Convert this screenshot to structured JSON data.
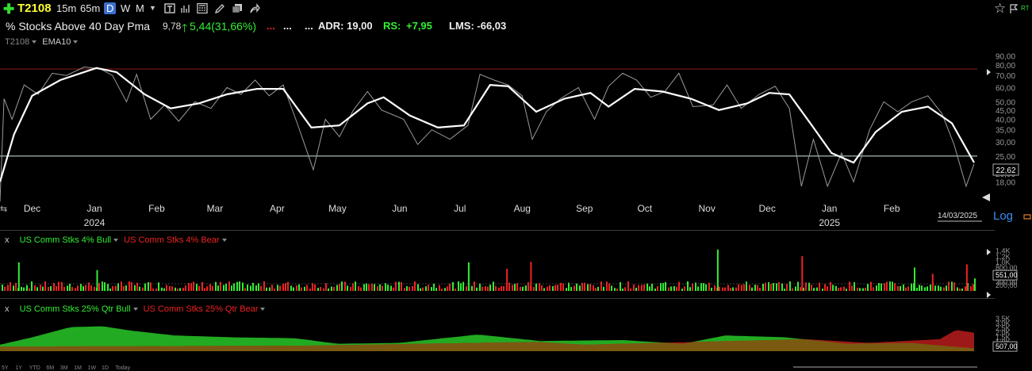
{
  "header": {
    "symbol": "T2108",
    "timeframes": [
      "15m",
      "65m",
      "D",
      "W",
      "M"
    ],
    "active_timeframe": "D",
    "right_badge": "RT"
  },
  "infobar": {
    "name": "% Stocks Above 40 Day Pma",
    "price": "9,78",
    "change": "5,44(31,66%)",
    "dots1": "...",
    "dots2": "...",
    "dots3": "...",
    "adr": "ADR: 19,00",
    "rs_label": "RS:",
    "rs_value": "+7,95",
    "lms": "LMS: -66,03"
  },
  "colors": {
    "up": "#33ee33",
    "down": "#ee2222",
    "symbol": "#ffff33",
    "ema": "#ffffff",
    "price_line": "#9a9a9a",
    "upper_line": "#8a1c1c",
    "lower_line": "#cfe9e2"
  },
  "chart_data": [
    {
      "type": "line",
      "legend": [
        "T2108",
        "EMA10"
      ],
      "x_ticks": [
        "Dec",
        "Jan",
        "Feb",
        "Mar",
        "Apr",
        "May",
        "Jun",
        "Jul",
        "Aug",
        "Sep",
        "Oct",
        "Nov",
        "Dec",
        "Jan",
        "Feb"
      ],
      "year_labels": [
        "2024",
        "2025"
      ],
      "y_scale": "log",
      "y_ticks": [
        "90,00",
        "80,00",
        "70,00",
        "60,00",
        "50,00",
        "45,00",
        "40,00",
        "35,00",
        "30,00",
        "25,00",
        "20,00",
        "18,00"
      ],
      "ylim": [
        16,
        95
      ],
      "last_value": "22,62",
      "date_label": "14/03/2025",
      "log_label": "Log",
      "hlines": [
        76,
        25
      ],
      "ema": [
        [
          "2023-11-15",
          18
        ],
        [
          "2023-11-22",
          33
        ],
        [
          "2023-12-01",
          54
        ],
        [
          "2023-12-15",
          66
        ],
        [
          "2024-01-02",
          77
        ],
        [
          "2024-01-12",
          73
        ],
        [
          "2024-01-26",
          55
        ],
        [
          "2024-02-08",
          46
        ],
        [
          "2024-02-22",
          49
        ],
        [
          "2024-03-07",
          55
        ],
        [
          "2024-03-22",
          59
        ],
        [
          "2024-04-04",
          59
        ],
        [
          "2024-04-18",
          36
        ],
        [
          "2024-05-02",
          37
        ],
        [
          "2024-05-16",
          49
        ],
        [
          "2024-05-24",
          53
        ],
        [
          "2024-06-06",
          42
        ],
        [
          "2024-06-20",
          36
        ],
        [
          "2024-07-03",
          37
        ],
        [
          "2024-07-16",
          62
        ],
        [
          "2024-07-25",
          61
        ],
        [
          "2024-08-08",
          44
        ],
        [
          "2024-08-22",
          52
        ],
        [
          "2024-09-04",
          56
        ],
        [
          "2024-09-13",
          47
        ],
        [
          "2024-09-26",
          59
        ],
        [
          "2024-10-10",
          57
        ],
        [
          "2024-10-24",
          52
        ],
        [
          "2024-11-07",
          45
        ],
        [
          "2024-11-21",
          49
        ],
        [
          "2024-12-02",
          56
        ],
        [
          "2024-12-12",
          55
        ],
        [
          "2024-12-24",
          36
        ],
        [
          "2025-01-02",
          26
        ],
        [
          "2025-01-13",
          23
        ],
        [
          "2025-01-24",
          34
        ],
        [
          "2025-02-06",
          44
        ],
        [
          "2025-02-19",
          47
        ],
        [
          "2025-03-03",
          38
        ],
        [
          "2025-03-14",
          23
        ]
      ],
      "price": [
        [
          "2023-11-15",
          14
        ],
        [
          "2023-11-17",
          52
        ],
        [
          "2023-11-21",
          40
        ],
        [
          "2023-11-27",
          62
        ],
        [
          "2023-12-04",
          55
        ],
        [
          "2023-12-11",
          72
        ],
        [
          "2023-12-18",
          70
        ],
        [
          "2023-12-27",
          78
        ],
        [
          "2024-01-04",
          76
        ],
        [
          "2024-01-10",
          70
        ],
        [
          "2024-01-17",
          50
        ],
        [
          "2024-01-22",
          71
        ],
        [
          "2024-01-29",
          40
        ],
        [
          "2024-02-05",
          48
        ],
        [
          "2024-02-12",
          39
        ],
        [
          "2024-02-20",
          50
        ],
        [
          "2024-02-28",
          46
        ],
        [
          "2024-03-07",
          60
        ],
        [
          "2024-03-14",
          55
        ],
        [
          "2024-03-21",
          66
        ],
        [
          "2024-03-28",
          54
        ],
        [
          "2024-04-04",
          62
        ],
        [
          "2024-04-11",
          38
        ],
        [
          "2024-04-19",
          21
        ],
        [
          "2024-04-25",
          40
        ],
        [
          "2024-05-02",
          32
        ],
        [
          "2024-05-09",
          45
        ],
        [
          "2024-05-16",
          57
        ],
        [
          "2024-05-23",
          45
        ],
        [
          "2024-06-03",
          40
        ],
        [
          "2024-06-10",
          29
        ],
        [
          "2024-06-17",
          35
        ],
        [
          "2024-06-26",
          31
        ],
        [
          "2024-07-05",
          37
        ],
        [
          "2024-07-11",
          71
        ],
        [
          "2024-07-18",
          66
        ],
        [
          "2024-07-25",
          62
        ],
        [
          "2024-08-01",
          54
        ],
        [
          "2024-08-06",
          31
        ],
        [
          "2024-08-13",
          44
        ],
        [
          "2024-08-20",
          52
        ],
        [
          "2024-08-29",
          60
        ],
        [
          "2024-09-06",
          40
        ],
        [
          "2024-09-13",
          61
        ],
        [
          "2024-09-20",
          72
        ],
        [
          "2024-09-27",
          66
        ],
        [
          "2024-10-04",
          53
        ],
        [
          "2024-10-11",
          57
        ],
        [
          "2024-10-18",
          72
        ],
        [
          "2024-10-25",
          47
        ],
        [
          "2024-11-04",
          48
        ],
        [
          "2024-11-11",
          62
        ],
        [
          "2024-11-18",
          46
        ],
        [
          "2024-11-27",
          55
        ],
        [
          "2024-12-05",
          61
        ],
        [
          "2024-12-12",
          46
        ],
        [
          "2024-12-18",
          17
        ],
        [
          "2024-12-24",
          31
        ],
        [
          "2024-12-31",
          17
        ],
        [
          "2025-01-07",
          26
        ],
        [
          "2025-01-13",
          18
        ],
        [
          "2025-01-21",
          35
        ],
        [
          "2025-01-28",
          50
        ],
        [
          "2025-02-04",
          44
        ],
        [
          "2025-02-11",
          50
        ],
        [
          "2025-02-19",
          54
        ],
        [
          "2025-02-26",
          43
        ],
        [
          "2025-03-04",
          29
        ],
        [
          "2025-03-10",
          17
        ],
        [
          "2025-03-14",
          22.62
        ]
      ]
    },
    {
      "type": "bar",
      "legend": [
        {
          "name": "US Comm Stks 4% Bull",
          "color": "#33ee33"
        },
        {
          "name": "US Comm Stks 4% Bear",
          "color": "#ee2222"
        }
      ],
      "y_ticks": [
        "1,4K",
        "1,2K",
        "1,0K",
        "800,00",
        "551,00",
        "300,00",
        "200,00"
      ],
      "ylim": [
        0,
        1500
      ],
      "last_value": "551,00",
      "bull_spikes": [
        [
          "2023-11-24",
          1000
        ],
        [
          "2024-01-02",
          730
        ],
        [
          "2024-07-05",
          1000
        ],
        [
          "2024-11-06",
          1450
        ],
        [
          "2025-02-12",
          820
        ],
        [
          "2025-03-14",
          440
        ]
      ],
      "bear_spikes": [
        [
          "2024-07-24",
          780
        ],
        [
          "2024-08-05",
          1020
        ],
        [
          "2024-12-18",
          1220
        ],
        [
          "2025-02-21",
          600
        ],
        [
          "2025-03-10",
          930
        ]
      ]
    },
    {
      "type": "area",
      "legend": [
        {
          "name": "US Comm Stks 25% Qtr Bull",
          "color": "#33cc33"
        },
        {
          "name": "US Comm Stks 25% Qtr Bear",
          "color": "#cc2222"
        }
      ],
      "y_ticks": [
        "3,5K",
        "3,0K",
        "2,5K",
        "2,0K",
        "1,5K",
        "1,0K",
        "507,00"
      ],
      "ylim": [
        0,
        3600
      ],
      "last_value": "507,00",
      "time_buttons": [
        "5Y",
        "1Y",
        "YTD",
        "6M",
        "3M",
        "1M",
        "1W",
        "1D",
        "Today"
      ],
      "bull": [
        [
          "2023-11-15",
          700
        ],
        [
          "2023-12-01",
          1500
        ],
        [
          "2023-12-20",
          2600
        ],
        [
          "2024-01-05",
          2700
        ],
        [
          "2024-01-20",
          2200
        ],
        [
          "2024-02-10",
          1700
        ],
        [
          "2024-03-10",
          1500
        ],
        [
          "2024-04-10",
          1400
        ],
        [
          "2024-05-01",
          800
        ],
        [
          "2024-06-01",
          900
        ],
        [
          "2024-07-10",
          1800
        ],
        [
          "2024-08-10",
          1100
        ],
        [
          "2024-09-20",
          1200
        ],
        [
          "2024-10-20",
          800
        ],
        [
          "2024-11-10",
          1700
        ],
        [
          "2024-12-10",
          1500
        ],
        [
          "2025-01-10",
          800
        ],
        [
          "2025-02-10",
          900
        ],
        [
          "2025-03-14",
          300
        ]
      ],
      "bear": [
        [
          "2023-11-15",
          500
        ],
        [
          "2024-04-15",
          600
        ],
        [
          "2024-08-08",
          1000
        ],
        [
          "2024-09-01",
          700
        ],
        [
          "2024-12-20",
          1300
        ],
        [
          "2025-01-20",
          900
        ],
        [
          "2025-02-25",
          1300
        ],
        [
          "2025-03-05",
          2300
        ],
        [
          "2025-03-14",
          2000
        ]
      ]
    }
  ]
}
